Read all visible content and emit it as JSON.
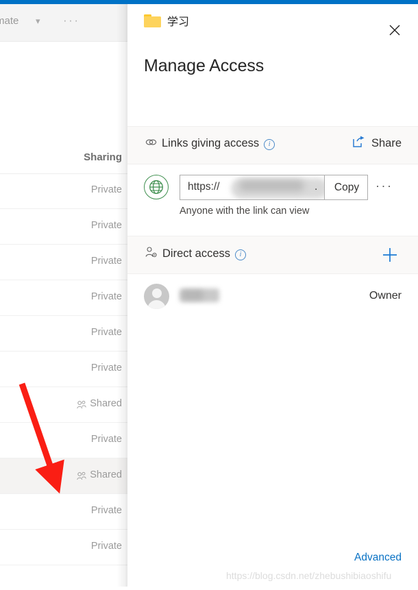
{
  "theme": {
    "accent_blue": "#0072c6",
    "link_blue": "#0a72c4",
    "section_bg": "#faf9f8",
    "folder_yellow": "#fdd35c",
    "globe_green": "#3f8f4f",
    "arrow_red": "#fa1e14",
    "selected_row_bg": "#f4f3f2"
  },
  "background_app": {
    "toolbar": {
      "automate_label": "mate",
      "chevron_icon": "chevron-down-icon",
      "overflow_label": "···"
    },
    "column_header": "Sharing",
    "rows": [
      {
        "label": "Private",
        "icon": null,
        "selected": false
      },
      {
        "label": "Private",
        "icon": null,
        "selected": false
      },
      {
        "label": "Private",
        "icon": null,
        "selected": false
      },
      {
        "label": "Private",
        "icon": null,
        "selected": false
      },
      {
        "label": "Private",
        "icon": null,
        "selected": false
      },
      {
        "label": "Private",
        "icon": null,
        "selected": false
      },
      {
        "label": "Shared",
        "icon": "people-icon",
        "selected": false
      },
      {
        "label": "Private",
        "icon": null,
        "selected": false
      },
      {
        "label": "Shared",
        "icon": "people-icon",
        "selected": true
      },
      {
        "label": "Private",
        "icon": null,
        "selected": false
      },
      {
        "label": "Private",
        "icon": null,
        "selected": false
      }
    ]
  },
  "panel": {
    "folder_icon": "folder-icon",
    "folder_name": "学习",
    "close_icon": "close-icon",
    "title": "Manage Access",
    "links_section": {
      "icon": "link-chain-icon",
      "title": "Links giving access",
      "info_icon": "info-icon",
      "share": {
        "icon": "share-icon",
        "label": "Share"
      },
      "link": {
        "scope_icon": "globe-icon",
        "url_value": "https://",
        "url_trailing": ".",
        "copy_label": "Copy",
        "more_label": "···",
        "description": "Anyone with the link can view"
      }
    },
    "direct_access_section": {
      "icon": "person-settings-icon",
      "title": "Direct access",
      "info_icon": "info-icon",
      "add_icon": "plus-icon",
      "people": [
        {
          "avatar": "avatar-placeholder",
          "name": "",
          "role": "Owner"
        }
      ]
    },
    "footer": {
      "advanced_label": "Advanced"
    }
  },
  "annotation": {
    "arrow": "red-arrow-pointing-to-selected-shared-row"
  },
  "watermark": "https://blog.csdn.net/zhebushibiaoshifu"
}
